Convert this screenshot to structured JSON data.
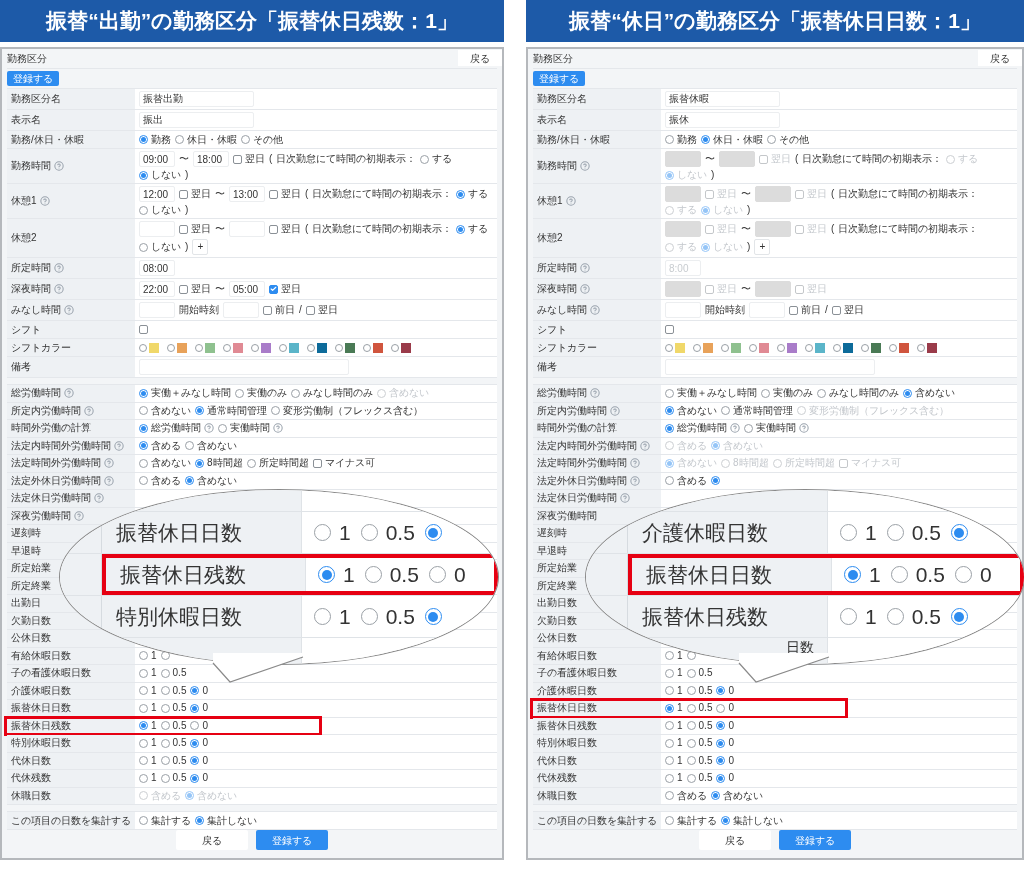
{
  "panels": [
    {
      "banner": "振替“出勤”の勤務区分「振替休日残数：1」",
      "header": "勤務区分",
      "back_button": "戻る",
      "register_button": "登録する",
      "sections": [
        {
          "rows": [
            {
              "label": "勤務区分名",
              "items": [
                {
                  "kind": "name_field",
                  "value": "振替出勤"
                }
              ]
            },
            {
              "label": "表示名",
              "items": [
                {
                  "kind": "name_field",
                  "value": "振出"
                }
              ]
            },
            {
              "label": "勤務/休日・休暇",
              "items": [
                {
                  "kind": "radio",
                  "label": "勤務",
                  "selected": true
                },
                {
                  "kind": "radio",
                  "label": "休日・休暇",
                  "selected": false
                },
                {
                  "kind": "radio",
                  "label": "その他",
                  "selected": false
                }
              ]
            },
            {
              "label": "勤務時間",
              "help": true,
              "items": [
                {
                  "kind": "time_field",
                  "value": "09:00"
                },
                {
                  "kind": "text",
                  "text": "〜"
                },
                {
                  "kind": "time_field",
                  "value": "18:00"
                },
                {
                  "kind": "checkbox",
                  "label": "翌日",
                  "checked": false
                },
                {
                  "kind": "text",
                  "text": "("
                },
                {
                  "kind": "text",
                  "text": "日次勤怠にて時間の初期表示："
                },
                {
                  "kind": "radio",
                  "label": "する",
                  "selected": false
                },
                {
                  "kind": "radio",
                  "label": "しない",
                  "selected": true
                },
                {
                  "kind": "text",
                  "text": ")"
                }
              ]
            },
            {
              "label": "休憩1",
              "help": true,
              "items": [
                {
                  "kind": "time_field",
                  "value": "12:00"
                },
                {
                  "kind": "checkbox",
                  "label": "翌日",
                  "checked": false
                },
                {
                  "kind": "text",
                  "text": "〜"
                },
                {
                  "kind": "time_field",
                  "value": "13:00"
                },
                {
                  "kind": "checkbox",
                  "label": "翌日",
                  "checked": false
                },
                {
                  "kind": "text",
                  "text": "("
                },
                {
                  "kind": "text",
                  "text": "日次勤怠にて時間の初期表示："
                },
                {
                  "kind": "radio",
                  "label": "する",
                  "selected": true
                },
                {
                  "kind": "radio",
                  "label": "しない",
                  "selected": false
                },
                {
                  "kind": "text",
                  "text": ")"
                }
              ]
            },
            {
              "label": "休憩2",
              "items": [
                {
                  "kind": "time_field"
                },
                {
                  "kind": "checkbox",
                  "label": "翌日",
                  "checked": false
                },
                {
                  "kind": "text",
                  "text": "〜"
                },
                {
                  "kind": "time_field"
                },
                {
                  "kind": "checkbox",
                  "label": "翌日",
                  "checked": false
                },
                {
                  "kind": "text",
                  "text": "("
                },
                {
                  "kind": "text",
                  "text": "日次勤怠にて時間の初期表示："
                },
                {
                  "kind": "radio",
                  "label": "する",
                  "selected": true
                },
                {
                  "kind": "radio",
                  "label": "しない",
                  "selected": false
                },
                {
                  "kind": "text",
                  "text": ")"
                },
                {
                  "kind": "plus",
                  "text": "+"
                }
              ]
            },
            {
              "label": "所定時間",
              "help": true,
              "items": [
                {
                  "kind": "time_field",
                  "value": "08:00"
                }
              ]
            },
            {
              "label": "深夜時間",
              "help": true,
              "items": [
                {
                  "kind": "time_field",
                  "value": "22:00"
                },
                {
                  "kind": "checkbox",
                  "label": "翌日",
                  "checked": false
                },
                {
                  "kind": "text",
                  "text": "〜"
                },
                {
                  "kind": "time_field",
                  "value": "05:00"
                },
                {
                  "kind": "checkbox",
                  "label": "翌日",
                  "checked": true
                }
              ]
            },
            {
              "label": "みなし時間",
              "help": true,
              "items": [
                {
                  "kind": "time_field"
                },
                {
                  "kind": "text",
                  "text": "開始時刻"
                },
                {
                  "kind": "time_field"
                },
                {
                  "kind": "checkbox",
                  "label": "前日",
                  "checked": false
                },
                {
                  "kind": "text",
                  "text": "/"
                },
                {
                  "kind": "checkbox",
                  "label": "翌日",
                  "checked": false
                }
              ]
            },
            {
              "label": "シフト",
              "items": [
                {
                  "kind": "checkbox",
                  "checked": false
                }
              ]
            },
            {
              "label": "シフトカラー",
              "items": [
                {
                  "kind": "swatch",
                  "color": "#f0d86a",
                  "selected": false
                },
                {
                  "kind": "swatch",
                  "color": "#e8a25a",
                  "selected": false
                },
                {
                  "kind": "swatch",
                  "color": "#8fc18f",
                  "selected": false
                },
                {
                  "kind": "swatch",
                  "color": "#e08a94",
                  "selected": false
                },
                {
                  "kind": "swatch",
                  "color": "#a97cc9",
                  "selected": false
                },
                {
                  "kind": "swatch",
                  "color": "#5bb5c9",
                  "selected": false
                },
                {
                  "kind": "swatch",
                  "color": "#0d6b9a",
                  "selected": false
                },
                {
                  "kind": "swatch",
                  "color": "#4a7a55",
                  "selected": false
                },
                {
                  "kind": "swatch",
                  "color": "#d0553e",
                  "selected": false
                },
                {
                  "kind": "swatch",
                  "color": "#9a3b4a",
                  "selected": false
                }
              ]
            },
            {
              "label": "備考",
              "items": [
                {
                  "kind": "note_field"
                }
              ]
            }
          ]
        },
        {
          "rows": [
            {
              "label": "総労働時間",
              "help": true,
              "items": [
                {
                  "kind": "radio",
                  "label": "実働＋みなし時間",
                  "selected": true
                },
                {
                  "kind": "radio",
                  "label": "実働のみ",
                  "selected": false
                },
                {
                  "kind": "radio",
                  "label": "みなし時間のみ",
                  "selected": false
                },
                {
                  "kind": "radio",
                  "label": "含めない",
                  "selected": false,
                  "disabled": true
                }
              ]
            },
            {
              "label": "所定内労働時間",
              "help": true,
              "items": [
                {
                  "kind": "radio",
                  "label": "含めない",
                  "selected": false
                },
                {
                  "kind": "radio",
                  "label": "通常時間管理",
                  "selected": true
                },
                {
                  "kind": "radio",
                  "label": "変形労働制（フレックス含む）",
                  "selected": false
                }
              ]
            },
            {
              "label": "時間外労働の計算",
              "items": [
                {
                  "kind": "radio",
                  "label": "総労働時間",
                  "help": true,
                  "selected": true
                },
                {
                  "kind": "radio",
                  "label": "実働時間",
                  "help": true,
                  "selected": false
                }
              ]
            },
            {
              "label": "法定内時間外労働時間",
              "help": true,
              "items": [
                {
                  "kind": "radio",
                  "label": "含める",
                  "selected": true
                },
                {
                  "kind": "radio",
                  "label": "含めない",
                  "selected": false
                }
              ]
            },
            {
              "label": "法定時間外労働時間",
              "help": true,
              "items": [
                {
                  "kind": "radio",
                  "label": "含めない",
                  "selected": false
                },
                {
                  "kind": "radio",
                  "label": "8時間超",
                  "selected": true
                },
                {
                  "kind": "radio",
                  "label": "所定時間超",
                  "selected": false
                },
                {
                  "kind": "checkbox",
                  "label": "マイナス可",
                  "checked": false
                }
              ]
            },
            {
              "label": "法定外休日労働時間",
              "help": true,
              "items": [
                {
                  "kind": "radio",
                  "label": "含める",
                  "selected": false
                },
                {
                  "kind": "radio",
                  "label": "含めない",
                  "selected": true
                }
              ]
            },
            {
              "label": "法定休日労働時間",
              "help": true,
              "items": []
            },
            {
              "label": "深夜労働時間",
              "help": true,
              "items": []
            },
            {
              "label": "遅刻時",
              "items": []
            },
            {
              "label": "早退時",
              "items": []
            },
            {
              "label": "所定始業",
              "items": []
            },
            {
              "label": "所定終業",
              "items": []
            },
            {
              "label": "出勤日",
              "items": []
            },
            {
              "label": "欠勤日数",
              "items": []
            },
            {
              "label": "公休日数",
              "items": []
            },
            {
              "label": "有給休暇日数",
              "items": [
                {
                  "kind": "radio",
                  "label": "1",
                  "selected": false
                },
                {
                  "kind": "radio",
                  "selected": false
                }
              ]
            },
            {
              "label": "子の看護休暇日数",
              "items": [
                {
                  "kind": "radio",
                  "label": "1",
                  "selected": false
                },
                {
                  "kind": "radio",
                  "label": "0.5",
                  "selected": false
                }
              ]
            },
            {
              "label": "介護休暇日数",
              "items": [
                {
                  "kind": "radio",
                  "label": "1",
                  "selected": false
                },
                {
                  "kind": "radio",
                  "label": "0.5",
                  "selected": false
                },
                {
                  "kind": "radio",
                  "label": "0",
                  "selected": true
                }
              ]
            },
            {
              "label": "振替休日日数",
              "items": [
                {
                  "kind": "radio",
                  "label": "1",
                  "selected": false
                },
                {
                  "kind": "radio",
                  "label": "0.5",
                  "selected": false
                },
                {
                  "kind": "radio",
                  "label": "0",
                  "selected": true
                }
              ]
            },
            {
              "label": "振替休日残数",
              "highlighted": true,
              "items": [
                {
                  "kind": "radio",
                  "label": "1",
                  "selected": true
                },
                {
                  "kind": "radio",
                  "label": "0.5",
                  "selected": false
                },
                {
                  "kind": "radio",
                  "label": "0",
                  "selected": false
                }
              ]
            },
            {
              "label": "特別休暇日数",
              "items": [
                {
                  "kind": "radio",
                  "label": "1",
                  "selected": false
                },
                {
                  "kind": "radio",
                  "label": "0.5",
                  "selected": false
                },
                {
                  "kind": "radio",
                  "label": "0",
                  "selected": true
                }
              ]
            },
            {
              "label": "代休日数",
              "items": [
                {
                  "kind": "radio",
                  "label": "1",
                  "selected": false
                },
                {
                  "kind": "radio",
                  "label": "0.5",
                  "selected": false
                },
                {
                  "kind": "radio",
                  "label": "0",
                  "selected": true
                }
              ]
            },
            {
              "label": "代休残数",
              "items": [
                {
                  "kind": "radio",
                  "label": "1",
                  "selected": false
                },
                {
                  "kind": "radio",
                  "label": "0.5",
                  "selected": false
                },
                {
                  "kind": "radio",
                  "label": "0",
                  "selected": true
                }
              ]
            },
            {
              "label": "休職日数",
              "items": [
                {
                  "kind": "radio",
                  "label": "含める",
                  "selected": false,
                  "disabled": true
                },
                {
                  "kind": "radio",
                  "label": "含めない",
                  "selected": true,
                  "disabled": true
                }
              ]
            }
          ]
        },
        {
          "rows": [
            {
              "label": "この項目の日数を集計する",
              "items": [
                {
                  "kind": "radio",
                  "label": "集計する",
                  "selected": false
                },
                {
                  "kind": "radio",
                  "label": "集計しない",
                  "selected": true
                }
              ]
            }
          ]
        }
      ],
      "magnifier": {
        "rows": [
          {
            "label": "振替休日日数",
            "highlighted": false,
            "options": [
              {
                "label": "1",
                "selected": false
              },
              {
                "label": "0.5",
                "selected": false
              },
              {
                "selected": true
              }
            ]
          },
          {
            "label": "振替休日残数",
            "highlighted": true,
            "options": [
              {
                "label": "1",
                "selected": true
              },
              {
                "label": "0.5",
                "selected": false
              },
              {
                "label": "0",
                "selected": false
              }
            ]
          },
          {
            "label": "特別休暇日数",
            "highlighted": false,
            "options": [
              {
                "label": "1",
                "selected": false
              },
              {
                "label": "0.5",
                "selected": false
              },
              {
                "selected": true
              }
            ]
          }
        ]
      },
      "footer_buttons": [
        {
          "label": "戻る",
          "primary": false
        },
        {
          "label": "登録する",
          "primary": true
        }
      ]
    },
    {
      "banner": "振替“休日”の勤務区分「振替休日日数：1」",
      "header": "勤務区分",
      "back_button": "戻る",
      "register_button": "登録する",
      "sections": [
        {
          "rows": [
            {
              "label": "勤務区分名",
              "items": [
                {
                  "kind": "name_field",
                  "value": "振替休暇"
                }
              ]
            },
            {
              "label": "表示名",
              "items": [
                {
                  "kind": "name_field",
                  "value": "振休"
                }
              ]
            },
            {
              "label": "勤務/休日・休暇",
              "items": [
                {
                  "kind": "radio",
                  "label": "勤務",
                  "selected": false
                },
                {
                  "kind": "radio",
                  "label": "休日・休暇",
                  "selected": true
                },
                {
                  "kind": "radio",
                  "label": "その他",
                  "selected": false
                }
              ]
            },
            {
              "label": "勤務時間",
              "help": true,
              "items": [
                {
                  "kind": "time_field",
                  "disabled": true
                },
                {
                  "kind": "text",
                  "text": "〜"
                },
                {
                  "kind": "time_field",
                  "disabled": true
                },
                {
                  "kind": "checkbox",
                  "label": "翌日",
                  "checked": false,
                  "disabled": true
                },
                {
                  "kind": "text",
                  "text": "("
                },
                {
                  "kind": "text",
                  "text": "日次勤怠にて時間の初期表示："
                },
                {
                  "kind": "radio",
                  "label": "する",
                  "selected": false,
                  "disabled": true
                },
                {
                  "kind": "radio",
                  "label": "しない",
                  "selected": true,
                  "disabled": true
                },
                {
                  "kind": "text",
                  "text": ")"
                }
              ]
            },
            {
              "label": "休憩1",
              "help": true,
              "items": [
                {
                  "kind": "time_field",
                  "disabled": true
                },
                {
                  "kind": "checkbox",
                  "label": "翌日",
                  "checked": false,
                  "disabled": true
                },
                {
                  "kind": "text",
                  "text": "〜"
                },
                {
                  "kind": "time_field",
                  "disabled": true
                },
                {
                  "kind": "checkbox",
                  "label": "翌日",
                  "checked": false,
                  "disabled": true
                },
                {
                  "kind": "text",
                  "text": "("
                },
                {
                  "kind": "text",
                  "text": "日次勤怠にて時間の初期表示："
                },
                {
                  "kind": "radio",
                  "label": "する",
                  "selected": false,
                  "disabled": true
                },
                {
                  "kind": "radio",
                  "label": "しない",
                  "selected": true,
                  "disabled": true
                },
                {
                  "kind": "text",
                  "text": ")"
                }
              ]
            },
            {
              "label": "休憩2",
              "items": [
                {
                  "kind": "time_field",
                  "disabled": true
                },
                {
                  "kind": "checkbox",
                  "label": "翌日",
                  "checked": false,
                  "disabled": true
                },
                {
                  "kind": "text",
                  "text": "〜"
                },
                {
                  "kind": "time_field",
                  "disabled": true
                },
                {
                  "kind": "checkbox",
                  "label": "翌日",
                  "checked": false,
                  "disabled": true
                },
                {
                  "kind": "text",
                  "text": "("
                },
                {
                  "kind": "text",
                  "text": "日次勤怠にて時間の初期表示："
                },
                {
                  "kind": "radio",
                  "label": "する",
                  "selected": false,
                  "disabled": true
                },
                {
                  "kind": "radio",
                  "label": "しない",
                  "selected": true,
                  "disabled": true
                },
                {
                  "kind": "text",
                  "text": ")"
                },
                {
                  "kind": "plus",
                  "text": "+"
                }
              ]
            },
            {
              "label": "所定時間",
              "help": true,
              "items": [
                {
                  "kind": "time_field",
                  "placeholder": "8:00"
                }
              ]
            },
            {
              "label": "深夜時間",
              "help": true,
              "items": [
                {
                  "kind": "time_field",
                  "disabled": true
                },
                {
                  "kind": "checkbox",
                  "label": "翌日",
                  "checked": false,
                  "disabled": true
                },
                {
                  "kind": "text",
                  "text": "〜"
                },
                {
                  "kind": "time_field",
                  "disabled": true
                },
                {
                  "kind": "checkbox",
                  "label": "翌日",
                  "checked": false,
                  "disabled": true
                }
              ]
            },
            {
              "label": "みなし時間",
              "help": true,
              "items": [
                {
                  "kind": "time_field"
                },
                {
                  "kind": "text",
                  "text": "開始時刻"
                },
                {
                  "kind": "time_field"
                },
                {
                  "kind": "checkbox",
                  "label": "前日",
                  "checked": false
                },
                {
                  "kind": "text",
                  "text": "/"
                },
                {
                  "kind": "checkbox",
                  "label": "翌日",
                  "checked": false
                }
              ]
            },
            {
              "label": "シフト",
              "items": [
                {
                  "kind": "checkbox",
                  "checked": false
                }
              ]
            },
            {
              "label": "シフトカラー",
              "items": [
                {
                  "kind": "swatch",
                  "color": "#f0d86a",
                  "selected": false
                },
                {
                  "kind": "swatch",
                  "color": "#e8a25a",
                  "selected": false
                },
                {
                  "kind": "swatch",
                  "color": "#8fc18f",
                  "selected": false
                },
                {
                  "kind": "swatch",
                  "color": "#e08a94",
                  "selected": false
                },
                {
                  "kind": "swatch",
                  "color": "#a97cc9",
                  "selected": false
                },
                {
                  "kind": "swatch",
                  "color": "#5bb5c9",
                  "selected": false
                },
                {
                  "kind": "swatch",
                  "color": "#0d6b9a",
                  "selected": false
                },
                {
                  "kind": "swatch",
                  "color": "#4a7a55",
                  "selected": false
                },
                {
                  "kind": "swatch",
                  "color": "#d0553e",
                  "selected": false
                },
                {
                  "kind": "swatch",
                  "color": "#9a3b4a",
                  "selected": false
                }
              ]
            },
            {
              "label": "備考",
              "items": [
                {
                  "kind": "note_field"
                }
              ]
            }
          ]
        },
        {
          "rows": [
            {
              "label": "総労働時間",
              "help": true,
              "items": [
                {
                  "kind": "radio",
                  "label": "実働＋みなし時間",
                  "selected": false
                },
                {
                  "kind": "radio",
                  "label": "実働のみ",
                  "selected": false
                },
                {
                  "kind": "radio",
                  "label": "みなし時間のみ",
                  "selected": false
                },
                {
                  "kind": "radio",
                  "label": "含めない",
                  "selected": true
                }
              ]
            },
            {
              "label": "所定内労働時間",
              "help": true,
              "items": [
                {
                  "kind": "radio",
                  "label": "含めない",
                  "selected": true
                },
                {
                  "kind": "radio",
                  "label": "通常時間管理",
                  "selected": false
                },
                {
                  "kind": "radio",
                  "label": "変形労働制（フレックス含む）",
                  "selected": false,
                  "disabled": true
                }
              ]
            },
            {
              "label": "時間外労働の計算",
              "items": [
                {
                  "kind": "radio",
                  "label": "総労働時間",
                  "help": true,
                  "selected": true
                },
                {
                  "kind": "radio",
                  "label": "実働時間",
                  "help": true,
                  "selected": false
                }
              ]
            },
            {
              "label": "法定内時間外労働時間",
              "help": true,
              "items": [
                {
                  "kind": "radio",
                  "label": "含める",
                  "selected": false,
                  "disabled": true
                },
                {
                  "kind": "radio",
                  "label": "含めない",
                  "selected": true,
                  "disabled": true
                }
              ]
            },
            {
              "label": "法定時間外労働時間",
              "help": true,
              "items": [
                {
                  "kind": "radio",
                  "label": "含めない",
                  "selected": true,
                  "disabled": true
                },
                {
                  "kind": "radio",
                  "label": "8時間超",
                  "selected": false,
                  "disabled": true
                },
                {
                  "kind": "radio",
                  "label": "所定時間超",
                  "selected": false,
                  "disabled": true
                },
                {
                  "kind": "checkbox",
                  "label": "マイナス可",
                  "checked": false,
                  "disabled": true
                }
              ]
            },
            {
              "label": "法定外休日労働時間",
              "help": true,
              "items": [
                {
                  "kind": "radio",
                  "label": "含める",
                  "selected": false
                },
                {
                  "kind": "radio",
                  "selected": true
                }
              ]
            },
            {
              "label": "法定休日労働時間",
              "help": true,
              "items": []
            },
            {
              "label": "深夜労働時間",
              "items": []
            },
            {
              "label": "遅刻時",
              "items": []
            },
            {
              "label": "早退時",
              "items": []
            },
            {
              "label": "所定始業",
              "items": []
            },
            {
              "label": "所定終業",
              "items": []
            },
            {
              "label": "出勤日数",
              "items": []
            },
            {
              "label": "欠勤日数",
              "items": []
            },
            {
              "label": "公休日数",
              "items": []
            },
            {
              "label": "有給休暇日数",
              "items": [
                {
                  "kind": "radio",
                  "label": "1",
                  "selected": false
                },
                {
                  "kind": "radio",
                  "selected": false
                }
              ]
            },
            {
              "label": "子の看護休暇日数",
              "items": [
                {
                  "kind": "radio",
                  "label": "1",
                  "selected": false
                },
                {
                  "kind": "radio",
                  "label": "0.5",
                  "selected": false
                }
              ]
            },
            {
              "label": "介護休暇日数",
              "items": [
                {
                  "kind": "radio",
                  "label": "1",
                  "selected": false
                },
                {
                  "kind": "radio",
                  "label": "0.5",
                  "selected": false
                },
                {
                  "kind": "radio",
                  "label": "0",
                  "selected": true
                }
              ]
            },
            {
              "label": "振替休日日数",
              "highlighted": true,
              "items": [
                {
                  "kind": "radio",
                  "label": "1",
                  "selected": true
                },
                {
                  "kind": "radio",
                  "label": "0.5",
                  "selected": false
                },
                {
                  "kind": "radio",
                  "label": "0",
                  "selected": false
                }
              ]
            },
            {
              "label": "振替休日残数",
              "items": [
                {
                  "kind": "radio",
                  "label": "1",
                  "selected": false
                },
                {
                  "kind": "radio",
                  "label": "0.5",
                  "selected": false
                },
                {
                  "kind": "radio",
                  "label": "0",
                  "selected": true
                }
              ]
            },
            {
              "label": "特別休暇日数",
              "items": [
                {
                  "kind": "radio",
                  "label": "1",
                  "selected": false
                },
                {
                  "kind": "radio",
                  "label": "0.5",
                  "selected": false
                },
                {
                  "kind": "radio",
                  "label": "0",
                  "selected": true
                }
              ]
            },
            {
              "label": "代休日数",
              "items": [
                {
                  "kind": "radio",
                  "label": "1",
                  "selected": false
                },
                {
                  "kind": "radio",
                  "label": "0.5",
                  "selected": false
                },
                {
                  "kind": "radio",
                  "label": "0",
                  "selected": true
                }
              ]
            },
            {
              "label": "代休残数",
              "items": [
                {
                  "kind": "radio",
                  "label": "1",
                  "selected": false
                },
                {
                  "kind": "radio",
                  "label": "0.5",
                  "selected": false
                },
                {
                  "kind": "radio",
                  "label": "0",
                  "selected": true
                }
              ]
            },
            {
              "label": "休職日数",
              "items": [
                {
                  "kind": "radio",
                  "label": "含める",
                  "selected": false
                },
                {
                  "kind": "radio",
                  "label": "含めない",
                  "selected": true
                }
              ]
            }
          ]
        },
        {
          "rows": [
            {
              "label": "この項目の日数を集計する",
              "items": [
                {
                  "kind": "radio",
                  "label": "集計する",
                  "selected": false
                },
                {
                  "kind": "radio",
                  "label": "集計しない",
                  "selected": true
                }
              ]
            }
          ]
        }
      ],
      "magnifier": {
        "tail_text": "日数",
        "rows": [
          {
            "label": "介護休暇日数",
            "highlighted": false,
            "options": [
              {
                "label": "1",
                "selected": false
              },
              {
                "label": "0.5",
                "selected": false
              },
              {
                "selected": true
              }
            ]
          },
          {
            "label": "振替休日日数",
            "highlighted": true,
            "options": [
              {
                "label": "1",
                "selected": true
              },
              {
                "label": "0.5",
                "selected": false
              },
              {
                "label": "0",
                "selected": false
              }
            ]
          },
          {
            "label": "振替休日残数",
            "highlighted": false,
            "options": [
              {
                "label": "1",
                "selected": false
              },
              {
                "label": "0.5",
                "selected": false
              },
              {
                "selected": true
              }
            ]
          }
        ]
      },
      "footer_buttons": [
        {
          "label": "戻る",
          "primary": false
        },
        {
          "label": "登録する",
          "primary": true
        }
      ]
    }
  ]
}
